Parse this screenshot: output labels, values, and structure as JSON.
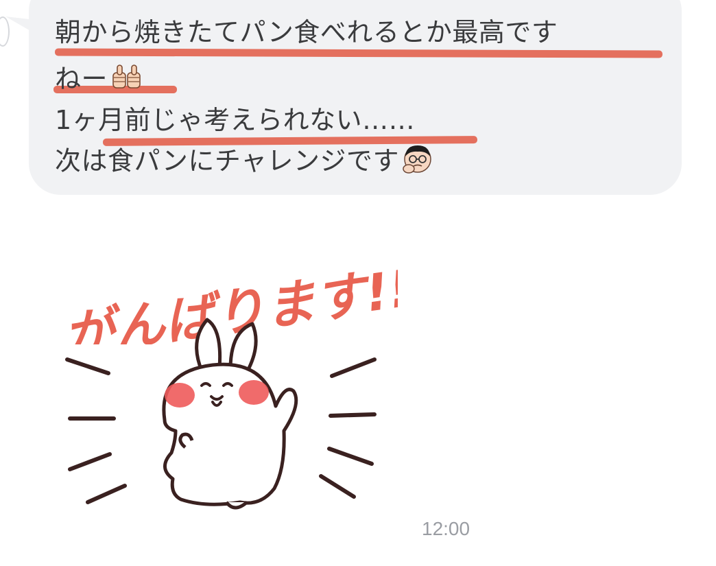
{
  "message": {
    "lines": [
      "朝から焼きたてパン食べれるとか最高です",
      "ねー",
      "1ヶ月前じゃ考えられない……",
      "次は食パンにチャレンジです"
    ],
    "emojis": [
      "thumbs-up-emoji",
      "thinking-face-emoji"
    ],
    "highlight_color": "#e0533d",
    "bubble_color": "#f1f2f4"
  },
  "sticker": {
    "text": "がんばります!!",
    "character": "rabbit"
  },
  "timestamp": "12:00",
  "colors": {
    "text": "#3a3b3d",
    "timestamp": "#9a9da3",
    "sticker_text": "#e86454"
  }
}
